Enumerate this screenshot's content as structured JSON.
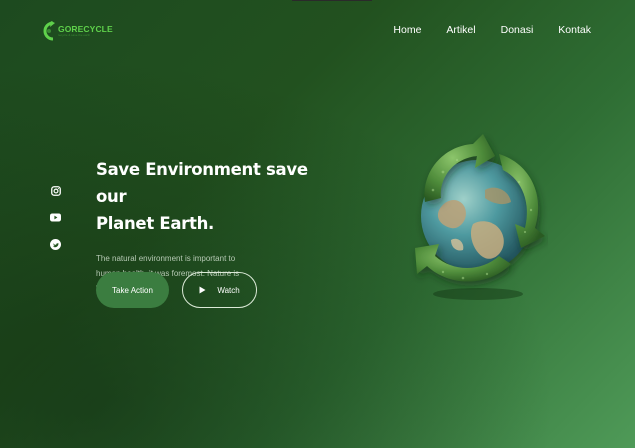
{
  "brand": {
    "name": "GORECYCLE",
    "tagline": "recycle & save the earth",
    "color": "#5fd14b"
  },
  "nav": {
    "items": [
      "Home",
      "Artikel",
      "Donasi",
      "Kontak"
    ]
  },
  "social": {
    "icons": [
      "instagram-icon",
      "youtube-icon",
      "twitter-icon"
    ]
  },
  "hero": {
    "title_line1": "Save Environment save our",
    "title_line2": "Planet Earth.",
    "description": "The natural environment is important to human health, it was foremost. Nature is very importance",
    "primary_button": "Take Action",
    "secondary_button": "Watch"
  },
  "colors": {
    "background_dark": "#1d4a1f",
    "background_light": "#4f9a58",
    "button_green": "#3b7d40"
  }
}
